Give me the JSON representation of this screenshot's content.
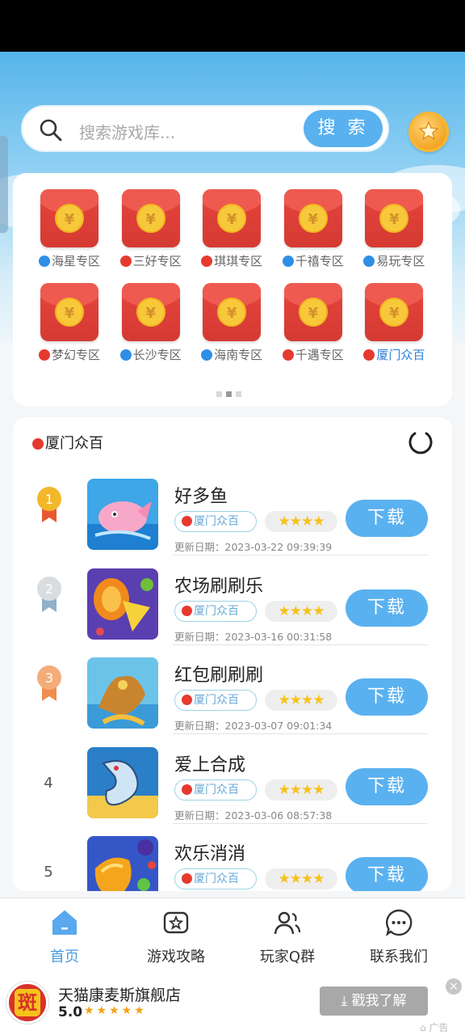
{
  "search": {
    "placeholder": "搜索游戏库...",
    "button": "搜 索"
  },
  "zones": [
    {
      "label": "海星专区",
      "dot": "blue"
    },
    {
      "label": "三好专区",
      "dot": "red"
    },
    {
      "label": "琪琪专区",
      "dot": "red"
    },
    {
      "label": "千禧专区",
      "dot": "blue"
    },
    {
      "label": "易玩专区",
      "dot": "blue"
    },
    {
      "label": "梦幻专区",
      "dot": "red"
    },
    {
      "label": "长沙专区",
      "dot": "blue"
    },
    {
      "label": "海南专区",
      "dot": "blue"
    },
    {
      "label": "千遇专区",
      "dot": "red"
    },
    {
      "label": "厦门众百",
      "dot": "red",
      "active": true
    }
  ],
  "coin_symbol": "¥",
  "list": {
    "title": "厦门众百",
    "items": [
      {
        "rank": "1",
        "name": "好多鱼",
        "tag": "厦门众百",
        "stars": "★★★★",
        "button": "下载",
        "update": "更新日期：2023-03-22 09:39:39"
      },
      {
        "rank": "2",
        "name": "农场刷刷乐",
        "tag": "厦门众百",
        "stars": "★★★★",
        "button": "下载",
        "update": "更新日期：2023-03-16 00:31:58"
      },
      {
        "rank": "3",
        "name": "红包刷刷刷",
        "tag": "厦门众百",
        "stars": "★★★★",
        "button": "下载",
        "update": "更新日期：2023-03-07 09:01:34"
      },
      {
        "rank": "4",
        "name": "爱上合成",
        "tag": "厦门众百",
        "stars": "★★★★",
        "button": "下载",
        "update": "更新日期：2023-03-06 08:57:38"
      },
      {
        "rank": "5",
        "name": "欢乐消消",
        "tag": "厦门众百",
        "stars": "★★★★",
        "button": "下载",
        "update": ""
      }
    ]
  },
  "tabs": [
    {
      "label": "首页",
      "icon": "home-icon",
      "active": true
    },
    {
      "label": "游戏攻略",
      "icon": "guide-icon"
    },
    {
      "label": "玩家Q群",
      "icon": "group-icon"
    },
    {
      "label": "联系我们",
      "icon": "chat-icon"
    }
  ],
  "ad": {
    "logo_text": "斑",
    "title": "天猫康麦斯旗舰店",
    "score": "5.0",
    "stars": "★★★★★",
    "button": "戳我了解",
    "mark": "广告",
    "close": "×"
  },
  "colors": {
    "accent": "#5ab1ef",
    "red": "#e63a2f",
    "blue": "#2f8fe6"
  }
}
